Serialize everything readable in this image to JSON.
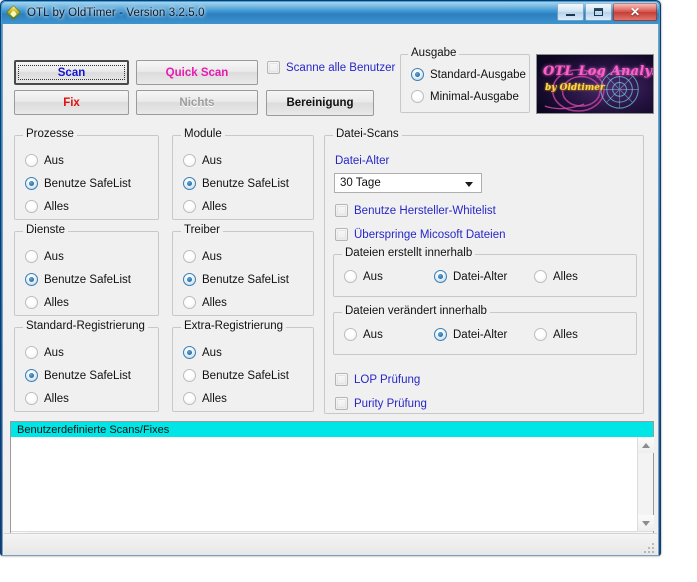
{
  "window": {
    "title": "OTL by OldTimer - Version 3.2.5.0",
    "icon": "otl-diamond-icon",
    "buttons": {
      "minimize": "minimize-button",
      "maximize": "maximize-button",
      "close": "✕"
    }
  },
  "toolbar": {
    "scan": "Scan",
    "quick_scan": "Quick Scan",
    "fix": "Fix",
    "nichts": "Nichts",
    "bereinigung": "Bereinigung",
    "scan_all_users": "Scanne alle Benutzer"
  },
  "ausgabe": {
    "legend": "Ausgabe",
    "options": [
      {
        "label": "Standard-Ausgabe",
        "selected": true
      },
      {
        "label": "Minimal-Ausgabe",
        "selected": false
      }
    ]
  },
  "logo": {
    "line1": "OTL Log Analysis",
    "line2": "by Oldtimer"
  },
  "option_groups": [
    {
      "legend": "Prozesse",
      "options": [
        {
          "label": "Aus",
          "selected": false
        },
        {
          "label": "Benutze SafeList",
          "selected": true
        },
        {
          "label": "Alles",
          "selected": false
        }
      ]
    },
    {
      "legend": "Module",
      "options": [
        {
          "label": "Aus",
          "selected": false
        },
        {
          "label": "Benutze SafeList",
          "selected": true
        },
        {
          "label": "Alles",
          "selected": false
        }
      ]
    },
    {
      "legend": "Dienste",
      "options": [
        {
          "label": "Aus",
          "selected": false
        },
        {
          "label": "Benutze SafeList",
          "selected": true
        },
        {
          "label": "Alles",
          "selected": false
        }
      ]
    },
    {
      "legend": "Treiber",
      "options": [
        {
          "label": "Aus",
          "selected": false
        },
        {
          "label": "Benutze SafeList",
          "selected": true
        },
        {
          "label": "Alles",
          "selected": false
        }
      ]
    },
    {
      "legend": "Standard-Registrierung",
      "options": [
        {
          "label": "Aus",
          "selected": false
        },
        {
          "label": "Benutze SafeList",
          "selected": true
        },
        {
          "label": "Alles",
          "selected": false
        }
      ]
    },
    {
      "legend": "Extra-Registrierung",
      "options": [
        {
          "label": "Aus",
          "selected": true
        },
        {
          "label": "Benutze SafeList",
          "selected": false
        },
        {
          "label": "Alles",
          "selected": false
        }
      ]
    }
  ],
  "datei_scans": {
    "legend": "Datei-Scans",
    "datei_alter_label": "Datei-Alter",
    "datei_alter_value": "30 Tage",
    "checkbox_whitelist": "Benutze Hersteller-Whitelist",
    "checkbox_skip_microsoft": "Überspringe Micosoft Dateien",
    "created_within": {
      "legend": "Dateien erstellt innerhalb",
      "options": [
        {
          "label": "Aus",
          "selected": false
        },
        {
          "label": "Datei-Alter",
          "selected": true
        },
        {
          "label": "Alles",
          "selected": false
        }
      ]
    },
    "modified_within": {
      "legend": "Dateien verändert innerhalb",
      "options": [
        {
          "label": "Aus",
          "selected": false
        },
        {
          "label": "Datei-Alter",
          "selected": true
        },
        {
          "label": "Alles",
          "selected": false
        }
      ]
    },
    "checkbox_lop": "LOP Prüfung",
    "checkbox_purity": "Purity Prüfung"
  },
  "custom_scans": {
    "header": "Benutzerdefinierte Scans/Fixes",
    "value": ""
  },
  "colors": {
    "scan_text": "#1414d0",
    "quick_scan_text": "#e81ab0",
    "fix_text": "#e01010",
    "link_blue": "#2727c8",
    "custom_header_bg": "#00e5e5",
    "titlebar_blue": "#3b93cf"
  }
}
